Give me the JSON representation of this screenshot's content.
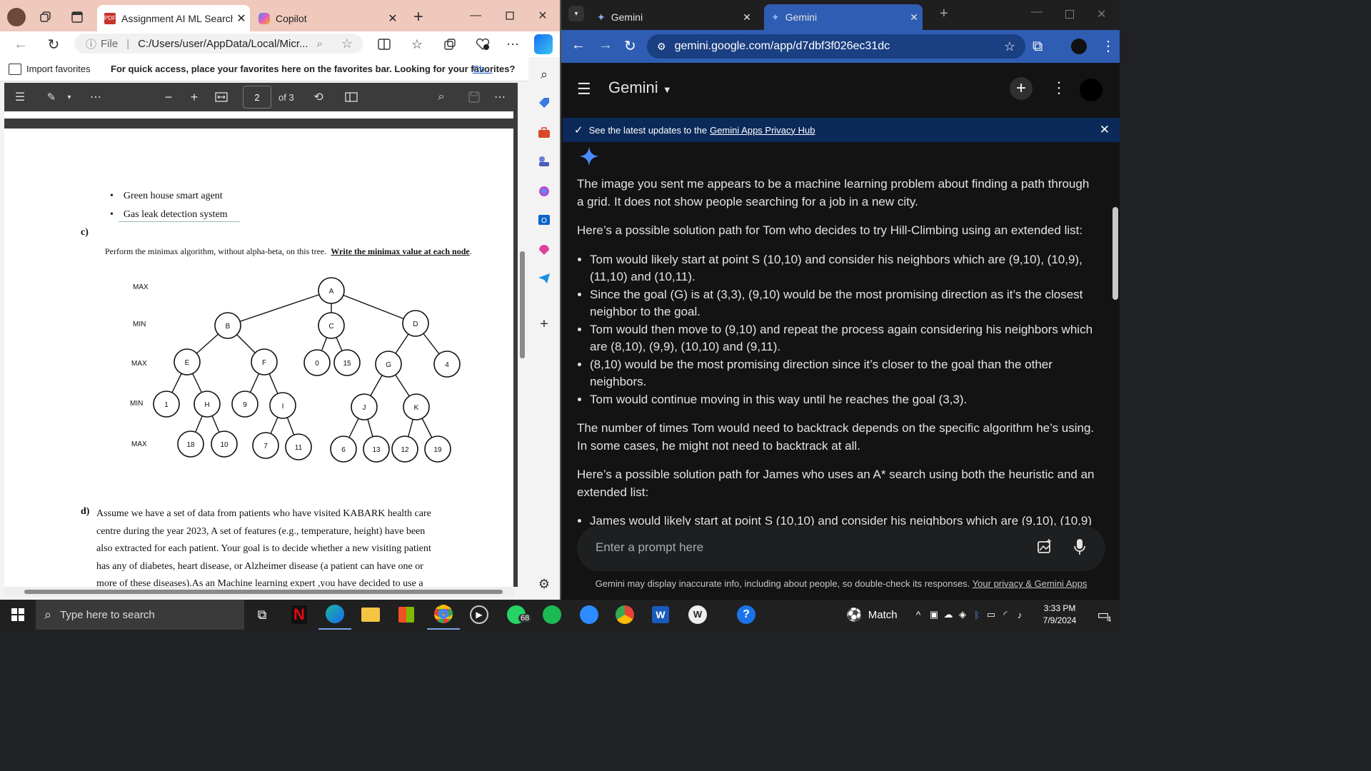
{
  "edge": {
    "tab_active_title": "Assignment AI ML Search A",
    "tab2_title": "Copilot",
    "address": "C:/Users/user/AppData/Local/Micr...",
    "address_prefix": "File",
    "import_favorites": "Import favorites",
    "favorites_msg": "For quick access, place your favorites here on the favorites bar. Looking for your favorites?",
    "favorites_link": "Ch...",
    "pdf_page": "2",
    "pdf_of": "of 3"
  },
  "doc": {
    "bullet1": "Green house smart agent",
    "bullet2": "Gas leak detection system",
    "c_label": "c)",
    "c_text": "Perform the minimax algorithm, without alpha-beta, on this tree.",
    "c_bold": "Write the minimax value at each node",
    "c_period": ".",
    "levels": [
      "MAX",
      "MIN",
      "MAX",
      "MIN",
      "MAX"
    ],
    "nodes": {
      "A": "A",
      "B": "B",
      "C": "C",
      "D": "D",
      "E": "E",
      "F": "F",
      "n0": "0",
      "n15": "15",
      "G": "G",
      "n4": "4",
      "n1": "1",
      "H": "H",
      "n9": "9",
      "I": "I",
      "J": "J",
      "K": "K",
      "n18": "18",
      "n10": "10",
      "n7": "7",
      "n11": "11",
      "n6": "6",
      "n13": "13",
      "n12": "12",
      "n19": "19"
    },
    "d_label": "d)",
    "d_lines": [
      "Assume we have a set of data from patients who have visited KABARK health  care",
      "centre during the year 2023, A set of features (e.g., temperature, height) have been",
      "also extracted for each patient. Your goal is to decide whether a new visiting patient",
      "has any of diabetes, heart disease, or Alzheimer  disease (a patient can have one or",
      "more of these diseases).As an Machine  learning expert ,you  have decided to use a"
    ]
  },
  "chrome": {
    "tab1_title": "Gemini",
    "tab2_title": "Gemini",
    "url": "gemini.google.com/app/d7dbf3f026ec31dc"
  },
  "gemini": {
    "app_name": "Gemini",
    "banner_text": "See the latest updates to the",
    "banner_link": "Gemini Apps Privacy Hub",
    "p1": "The image you sent me appears to be a machine learning problem about finding a path through a grid. It does not show people searching for a job in a new city.",
    "p2": "Here’s a possible solution path for Tom who decides to try Hill-Climbing using an extended list:",
    "list1": [
      "Tom would likely start at point S (10,10) and consider his neighbors which are (9,10), (10,9), (11,10) and (10,11).",
      "Since the goal (G) is at (3,3), (9,10) would be the most promising direction as it’s the closest neighbor to the goal.",
      "Tom would then move to (9,10) and repeat the process again considering his neighbors which are (8,10), (9,9), (10,10) and (9,11).",
      "(8,10) would be the most promising direction since it’s closer to the goal than the other neighbors.",
      "Tom would continue moving in this way until he reaches the goal (3,3)."
    ],
    "p3": "The number of times Tom would need to backtrack depends on the specific algorithm he’s using. In some cases, he might not need to backtrack at all.",
    "p4": "Here’s a possible solution path for James who uses an A* search using both the heuristic and an extended list:",
    "list2_partial": "James would likely start at point S (10,10) and consider his neighbors which are (9,10), (10,9)",
    "prompt_placeholder": "Enter a prompt here",
    "footer_text": "Gemini may display inaccurate info, including about people, so double-check its responses.",
    "footer_link": "Your privacy & Gemini Apps"
  },
  "taskbar": {
    "search_placeholder": "Type here to search",
    "whatsapp_badge": "68",
    "weather_label": "Match",
    "time": "3:33 PM",
    "date": "7/9/2024",
    "notif_count": "4"
  }
}
